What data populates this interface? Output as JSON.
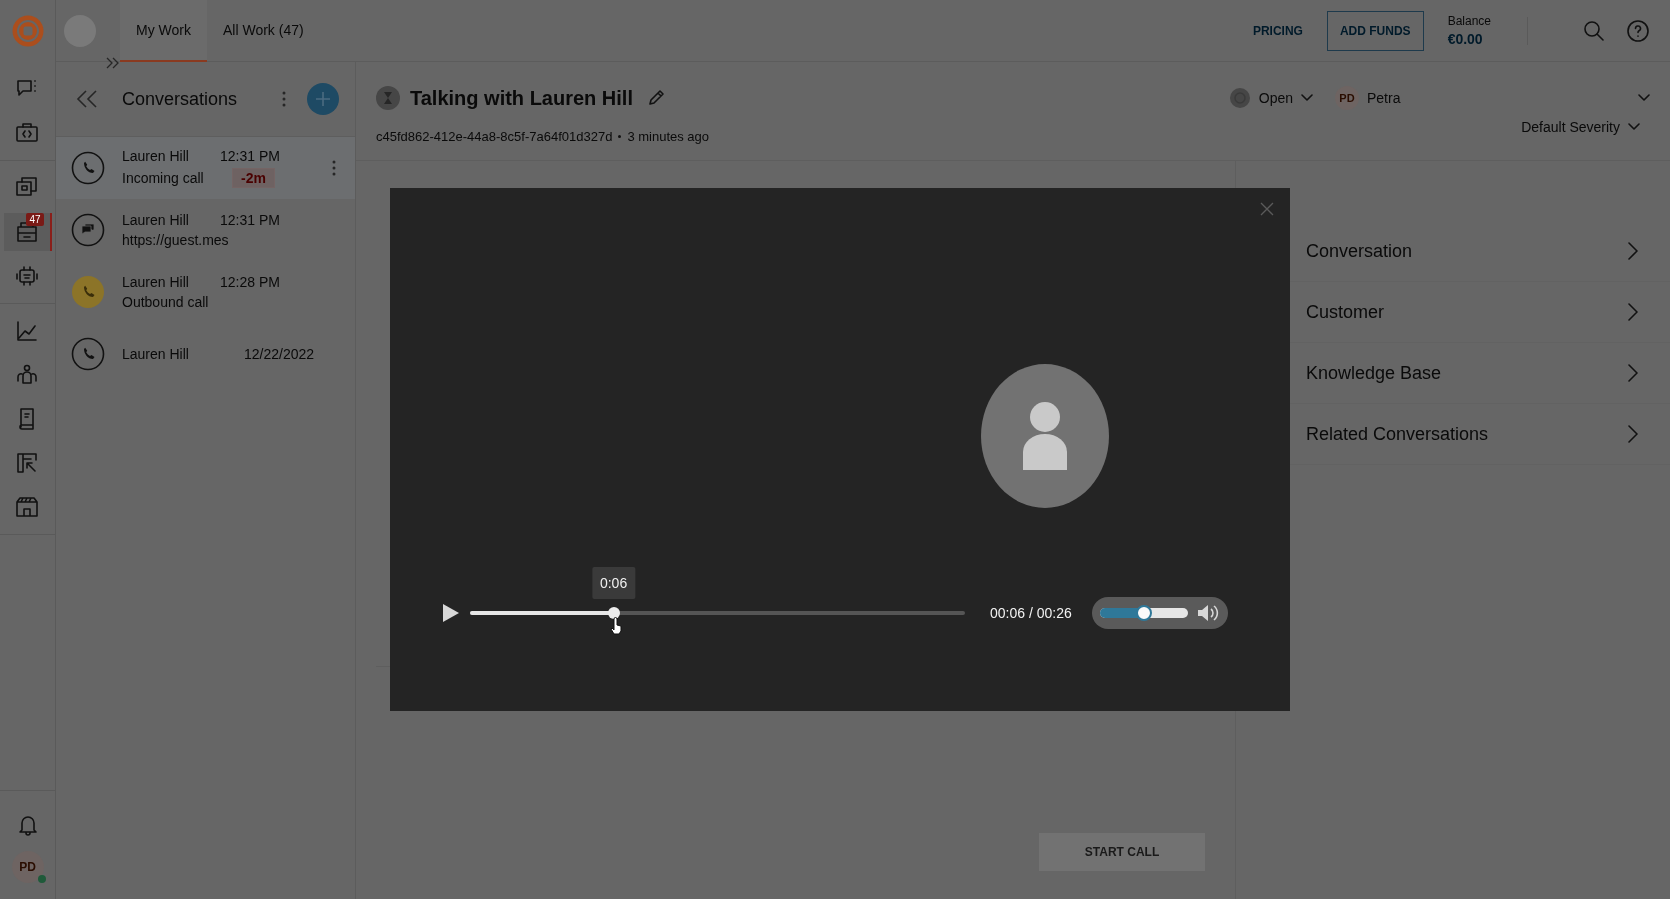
{
  "nav_rail": {
    "groups": [
      {
        "items": [
          {
            "selected": false
          },
          {
            "selected": false
          }
        ]
      },
      {
        "items": [
          {
            "selected": false
          },
          {
            "selected": true,
            "badge": "47"
          },
          {
            "selected": false
          }
        ]
      },
      {
        "items": [
          {
            "selected": false
          },
          {
            "selected": false
          },
          {
            "selected": false
          },
          {
            "selected": false
          },
          {
            "selected": false
          }
        ]
      }
    ]
  },
  "user": {
    "initials": "PD",
    "online": true
  },
  "tabs": [
    {
      "label": "My Work",
      "selected": true
    },
    {
      "label": "All Work (47)",
      "selected": false
    }
  ],
  "header_actions": {
    "pricing": "PRICING",
    "add_funds": "ADD FUNDS",
    "balance_label": "Balance",
    "balance": "€0.00"
  },
  "conversations": {
    "title": "Conversations",
    "items": [
      {
        "kind": "call",
        "name": "Lauren Hill",
        "time": "12:31 PM",
        "preview": "Incoming call",
        "badge": "-2m",
        "selected": true
      },
      {
        "kind": "chat",
        "name": "Lauren Hill",
        "time": "12:31 PM",
        "preview": "https://guest.mes",
        "selected": false
      },
      {
        "kind": "outbound",
        "name": "Lauren Hill",
        "time": "12:28 PM",
        "preview": "Outbound call",
        "selected": false
      },
      {
        "kind": "call",
        "name": "Lauren Hill",
        "time": "12/22/2022",
        "selected": false
      }
    ]
  },
  "conversation": {
    "title": "Talking with Lauren Hill",
    "id": "c45fd862-412e-44a8-8c5f-7a64f01d327d",
    "age": "3 minutes ago",
    "status": "Open",
    "assignee_initials": "PD",
    "assignee": "Petra",
    "severity": "Default Severity",
    "start_call": "START CALL"
  },
  "side_panel": {
    "sections": [
      "Conversation",
      "Customer",
      "Knowledge Base",
      "Related Conversations"
    ]
  },
  "player": {
    "tooltip": "0:06",
    "level": 0.29,
    "time": "00:06 / 00:26",
    "volume": {
      "level": 0.5
    }
  }
}
